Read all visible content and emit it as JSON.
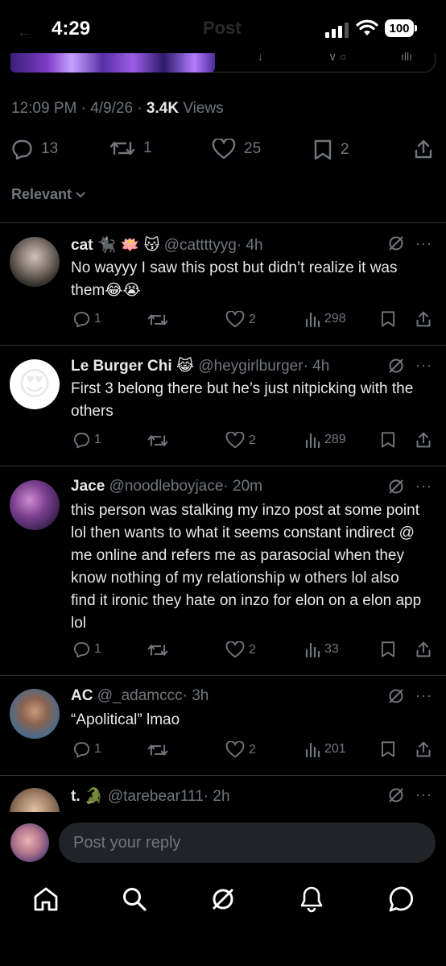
{
  "status": {
    "time": "4:29",
    "battery": "100",
    "faded_title": "Post"
  },
  "post": {
    "timestamp": "12:09 PM · 4/9/26 · ",
    "views_count": "3.4K",
    "views_label": " Views",
    "replies": "13",
    "reposts": "1",
    "likes": "25",
    "bookmarks": "2"
  },
  "sort": {
    "label": "Relevant"
  },
  "replies": [
    {
      "name": "cat",
      "emoji": "🐈‍⬛ 🪷 😽",
      "handle": "@cattttyyg",
      "time": "· 4h",
      "text": "No wayyy I saw this post but didn’t realize it was them😂😭",
      "replies": "1",
      "likes": "2",
      "views": "298"
    },
    {
      "name": "Le Burger Chi",
      "emoji": "😹",
      "handle": "@heygirlburger",
      "time": "· 4h",
      "text": "First 3 belong there but he’s just nitpicking with the others",
      "replies": "1",
      "likes": "2",
      "views": "289"
    },
    {
      "name": "Jace",
      "emoji": "",
      "handle": "@noodleboyjace",
      "time": "· 20m",
      "text": "this person was stalking my inzo post at some point lol then wants to what it seems constant indirect @ me online and refers me as parasocial when they know nothing of my relationship w others lol also find it ironic they hate on inzo for elon on a elon app lol",
      "replies": "1",
      "likes": "2",
      "views": "33"
    },
    {
      "name": "AC",
      "emoji": "",
      "handle": "@_adamccc",
      "time": "· 3h",
      "text": "“Apolitical” lmao",
      "replies": "1",
      "likes": "2",
      "views": "201"
    },
    {
      "name": "t.",
      "emoji": "🐊",
      "handle": "@tarebear111",
      "time": "· 2h"
    }
  ],
  "composer": {
    "placeholder": "Post your reply"
  },
  "tabs": [
    "home",
    "search",
    "grok",
    "notifications",
    "messages"
  ]
}
